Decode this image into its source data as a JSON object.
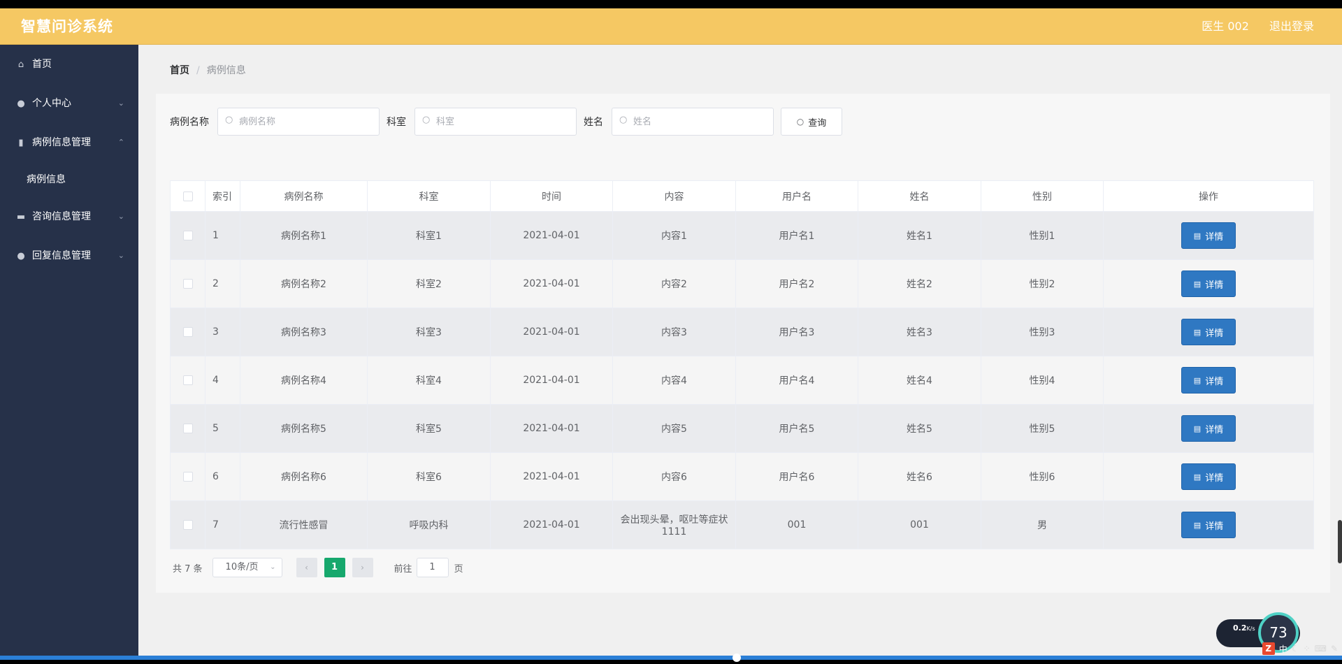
{
  "header": {
    "title": "智慧问诊系统",
    "user": "医生 002",
    "logout": "退出登录"
  },
  "sidebar": {
    "items": [
      {
        "label": "首页",
        "icon": "home-icon",
        "glyph": "⌂",
        "arrow": ""
      },
      {
        "label": "个人中心",
        "icon": "user-icon",
        "glyph": "●",
        "arrow": "⌄"
      },
      {
        "label": "病例信息管理",
        "icon": "chart-icon",
        "glyph": "▮",
        "arrow": "⌃"
      },
      {
        "label": "咨询信息管理",
        "icon": "printer-icon",
        "glyph": "▬",
        "arrow": "⌄"
      },
      {
        "label": "回复信息管理",
        "icon": "person-icon",
        "glyph": "●",
        "arrow": "⌄"
      }
    ],
    "sub_item": "病例信息"
  },
  "breadcrumb": {
    "home": "首页",
    "sep": "/",
    "current": "病例信息"
  },
  "search": {
    "case_label": "病例名称",
    "case_placeholder": "病例名称",
    "dept_label": "科室",
    "dept_placeholder": "科室",
    "name_label": "姓名",
    "name_placeholder": "姓名",
    "query_button": "查询"
  },
  "table": {
    "headers": [
      "索引",
      "病例名称",
      "科室",
      "时间",
      "内容",
      "用户名",
      "姓名",
      "性别",
      "操作"
    ],
    "detail_label": "详情",
    "rows": [
      {
        "index": "1",
        "case": "病例名称1",
        "dept": "科室1",
        "time": "2021-04-01",
        "content": "内容1",
        "username": "用户名1",
        "name": "姓名1",
        "gender": "性别1"
      },
      {
        "index": "2",
        "case": "病例名称2",
        "dept": "科室2",
        "time": "2021-04-01",
        "content": "内容2",
        "username": "用户名2",
        "name": "姓名2",
        "gender": "性别2"
      },
      {
        "index": "3",
        "case": "病例名称3",
        "dept": "科室3",
        "time": "2021-04-01",
        "content": "内容3",
        "username": "用户名3",
        "name": "姓名3",
        "gender": "性别3"
      },
      {
        "index": "4",
        "case": "病例名称4",
        "dept": "科室4",
        "time": "2021-04-01",
        "content": "内容4",
        "username": "用户名4",
        "name": "姓名4",
        "gender": "性别4"
      },
      {
        "index": "5",
        "case": "病例名称5",
        "dept": "科室5",
        "time": "2021-04-01",
        "content": "内容5",
        "username": "用户名5",
        "name": "姓名5",
        "gender": "性别5"
      },
      {
        "index": "6",
        "case": "病例名称6",
        "dept": "科室6",
        "time": "2021-04-01",
        "content": "内容6",
        "username": "用户名6",
        "name": "姓名6",
        "gender": "性别6"
      },
      {
        "index": "7",
        "case": "流行性感冒",
        "dept": "呼吸内科",
        "time": "2021-04-01",
        "content": "会出现头晕，呕吐等症状1111",
        "username": "001",
        "name": "001",
        "gender": "男"
      }
    ]
  },
  "pager": {
    "total": "共 7 条",
    "page_size": "10条/页",
    "current_page": "1",
    "goto_label": "前往",
    "goto_value": "1",
    "goto_suffix": "页",
    "prev": "‹",
    "next": "›"
  },
  "system_tray": {
    "net_speed": "0.2",
    "net_unit": "K/s",
    "cpu": "73",
    "ime": "中"
  },
  "colors": {
    "header": "#f5c863",
    "sidebar": "#263149",
    "detail_button": "#2f78c2",
    "page_active": "#17a86d"
  }
}
